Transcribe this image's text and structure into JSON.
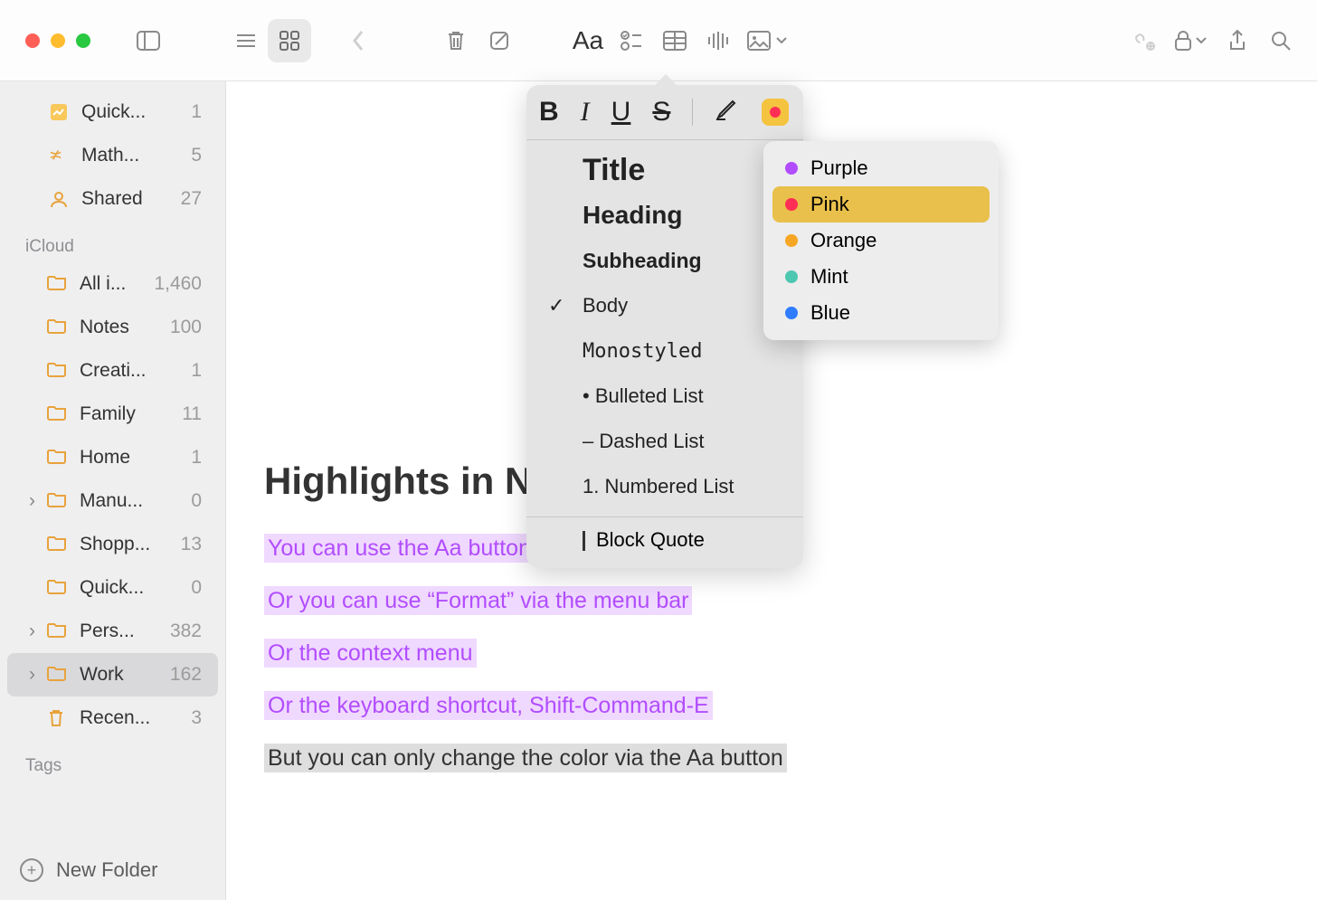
{
  "toolbar": {
    "view_list": "list-icon",
    "view_grid": "grid-icon",
    "back": "back-icon",
    "trash": "trash-icon",
    "compose": "compose-icon",
    "format": "Aa",
    "checklist": "checklist-icon",
    "table": "table-icon",
    "audio": "waveform-icon",
    "media": "photo-icon",
    "link": "link-icon",
    "lock": "lock-icon",
    "share": "share-icon",
    "search": "search-icon"
  },
  "sidebar": {
    "top_items": [
      {
        "icon": "quick-note",
        "label": "Quick...",
        "count": "1"
      },
      {
        "icon": "math",
        "label": "Math...",
        "count": "5"
      },
      {
        "icon": "shared",
        "label": "Shared",
        "count": "27"
      }
    ],
    "section_label": "iCloud",
    "folders": [
      {
        "label": "All i...",
        "count": "1,460",
        "disclosure": false
      },
      {
        "label": "Notes",
        "count": "100",
        "disclosure": false
      },
      {
        "label": "Creati...",
        "count": "1",
        "disclosure": false
      },
      {
        "label": "Family",
        "count": "11",
        "disclosure": false
      },
      {
        "label": "Home",
        "count": "1",
        "disclosure": false
      },
      {
        "label": "Manu...",
        "count": "0",
        "disclosure": true
      },
      {
        "label": "Shopp...",
        "count": "13",
        "disclosure": false
      },
      {
        "label": "Quick...",
        "count": "0",
        "disclosure": false
      },
      {
        "label": "Pers...",
        "count": "382",
        "disclosure": true
      },
      {
        "label": "Work",
        "count": "162",
        "disclosure": true,
        "selected": true
      },
      {
        "label": "Recen...",
        "count": "3",
        "trash": true
      }
    ],
    "tags_label": "Tags",
    "new_folder": "New Folder"
  },
  "note": {
    "title": "Highlights in Notes",
    "lines": [
      {
        "text": "You can use the Aa button",
        "style": "purple"
      },
      {
        "text": "Or you can use “Format” via the menu bar",
        "style": "purple"
      },
      {
        "text": "Or the context menu",
        "style": "purple"
      },
      {
        "text": "Or the keyboard shortcut, Shift-Command-E",
        "style": "purple"
      },
      {
        "text": "But you can only change the color via the Aa button",
        "style": "grey"
      }
    ]
  },
  "format_panel": {
    "bold": "B",
    "italic": "I",
    "underline": "U",
    "strike": "S",
    "styles": [
      {
        "label": "Title",
        "class": "title"
      },
      {
        "label": "Heading",
        "class": "heading"
      },
      {
        "label": "Subheading",
        "class": "subheading"
      },
      {
        "label": "Body",
        "class": "body",
        "checked": true
      },
      {
        "label": "Monostyled",
        "class": "mono"
      },
      {
        "label": "• Bulleted List",
        "class": "bl"
      },
      {
        "label": "– Dashed List",
        "class": "dl"
      },
      {
        "label": "1. Numbered List",
        "class": "nl"
      }
    ],
    "block_quote": "Block Quote"
  },
  "color_menu": {
    "items": [
      {
        "label": "Purple",
        "color": "#b24dff"
      },
      {
        "label": "Pink",
        "color": "#ff2e55",
        "selected": true
      },
      {
        "label": "Orange",
        "color": "#f5a623"
      },
      {
        "label": "Mint",
        "color": "#4ec7b0"
      },
      {
        "label": "Blue",
        "color": "#2f7cff"
      }
    ]
  }
}
